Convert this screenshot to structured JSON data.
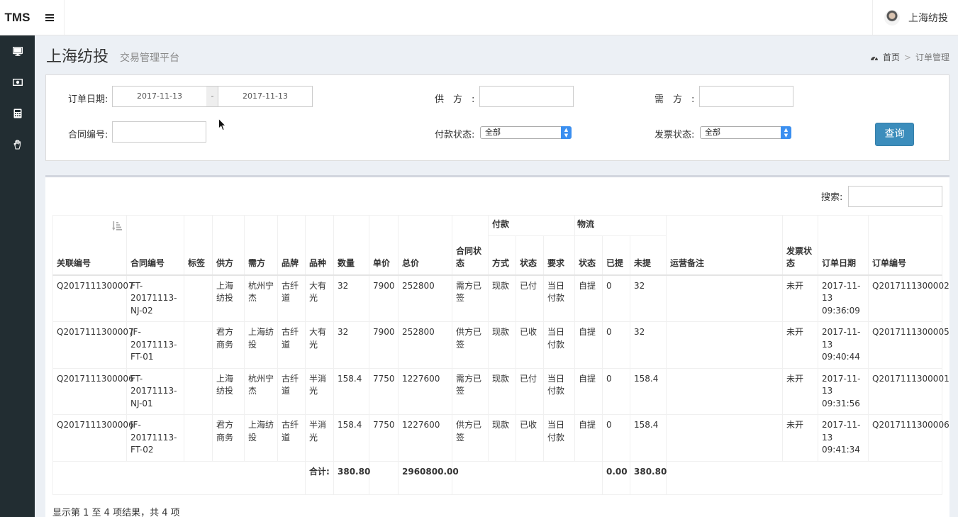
{
  "header": {
    "logo": "TMS",
    "user_name": "上海纺投"
  },
  "sidebar": {
    "items": [
      {
        "icon": "desktop-icon"
      },
      {
        "icon": "money-icon"
      },
      {
        "icon": "calculator-icon"
      },
      {
        "icon": "hand-icon"
      }
    ]
  },
  "page": {
    "title": "上海纺投",
    "subtitle": "交易管理平台"
  },
  "breadcrumb": {
    "home": "首页",
    "separator": ">",
    "current": "订单管理"
  },
  "filters": {
    "order_date_label": "订单日期:",
    "date_from": "2017-11-13",
    "date_sep": "-",
    "date_to": "2017-11-13",
    "supplier_label": "供　方　:",
    "supplier_value": "",
    "demander_label": "需　方　:",
    "demander_value": "",
    "contract_no_label": "合同编号:",
    "contract_no_value": "",
    "payment_status_label": "付款状态:",
    "payment_status_value": "全部",
    "invoice_status_label": "发票状态:",
    "invoice_status_value": "全部",
    "query_button": "查询"
  },
  "table": {
    "search_label": "搜索:",
    "search_value": "",
    "headers": {
      "related_no": "关联编号",
      "contract_no": "合同编号",
      "tag": "标签",
      "supplier": "供方",
      "demander": "需方",
      "brand": "品牌",
      "variety": "品种",
      "quantity": "数量",
      "unit_price": "单价",
      "total_price": "总价",
      "contract_status": "合同状态",
      "payment_group": "付款",
      "pay_method": "方式",
      "pay_status": "状态",
      "pay_requirement": "要求",
      "logistics_group": "物流",
      "logistics_status": "状态",
      "picked": "已提",
      "unpicked": "未提",
      "ops_note": "运营备注",
      "invoice_status": "发票状态",
      "order_date": "订单日期",
      "order_no": "订单编号"
    },
    "rows": [
      {
        "related_no": "Q2017111300007",
        "contract_no": "FT-20171113-NJ-02",
        "tag": "",
        "supplier": "上海纺投",
        "demander": "杭州宁杰",
        "brand": "古纤道",
        "variety": "大有光",
        "quantity": "32",
        "unit_price": "7900",
        "total_price": "252800",
        "contract_status": "需方已签",
        "pay_method": "现款",
        "pay_status": "已付",
        "pay_requirement": "当日付款",
        "logistics_status": "自提",
        "picked": "0",
        "unpicked": "32",
        "ops_note": "",
        "invoice_status": "未开",
        "order_date": "2017-11-13 09:36:09",
        "order_no": "Q2017111300002"
      },
      {
        "related_no": "Q2017111300007",
        "contract_no": "JF-20171113-FT-01",
        "tag": "",
        "supplier": "君方商务",
        "demander": "上海纺投",
        "brand": "古纤道",
        "variety": "大有光",
        "quantity": "32",
        "unit_price": "7900",
        "total_price": "252800",
        "contract_status": "供方已签",
        "pay_method": "现款",
        "pay_status": "已收",
        "pay_requirement": "当日付款",
        "logistics_status": "自提",
        "picked": "0",
        "unpicked": "32",
        "ops_note": "",
        "invoice_status": "未开",
        "order_date": "2017-11-13 09:40:44",
        "order_no": "Q2017111300005"
      },
      {
        "related_no": "Q2017111300006",
        "contract_no": "FT-20171113-NJ-01",
        "tag": "",
        "supplier": "上海纺投",
        "demander": "杭州宁杰",
        "brand": "古纤道",
        "variety": "半消光",
        "quantity": "158.4",
        "unit_price": "7750",
        "total_price": "1227600",
        "contract_status": "需方已签",
        "pay_method": "现款",
        "pay_status": "已付",
        "pay_requirement": "当日付款",
        "logistics_status": "自提",
        "picked": "0",
        "unpicked": "158.4",
        "ops_note": "",
        "invoice_status": "未开",
        "order_date": "2017-11-13 09:31:56",
        "order_no": "Q2017111300001"
      },
      {
        "related_no": "Q2017111300006",
        "contract_no": "JF-20171113-FT-02",
        "tag": "",
        "supplier": "君方商务",
        "demander": "上海纺投",
        "brand": "古纤道",
        "variety": "半消光",
        "quantity": "158.4",
        "unit_price": "7750",
        "total_price": "1227600",
        "contract_status": "供方已签",
        "pay_method": "现款",
        "pay_status": "已收",
        "pay_requirement": "当日付款",
        "logistics_status": "自提",
        "picked": "0",
        "unpicked": "158.4",
        "ops_note": "",
        "invoice_status": "未开",
        "order_date": "2017-11-13 09:41:34",
        "order_no": "Q2017111300006"
      }
    ],
    "totals": {
      "label": "合计:",
      "quantity": "380.80",
      "total_price": "2960800.00",
      "picked": "0.00",
      "unpicked": "380.80"
    },
    "info": "显示第 1 至 4 项结果，共 4 项"
  }
}
